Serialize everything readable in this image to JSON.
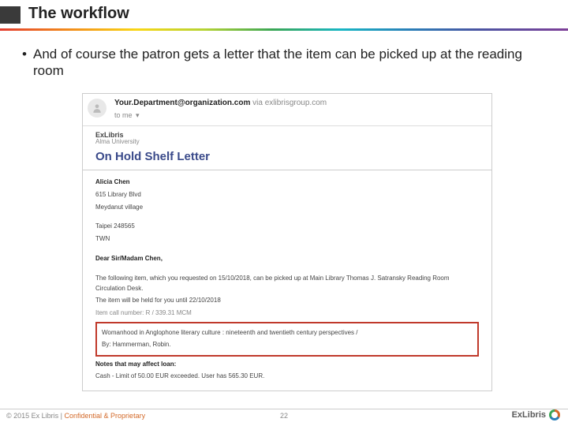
{
  "title": "The workflow",
  "bullet": "And of course the patron gets a letter that the item can be picked up at the reading room",
  "email": {
    "from": "Your.Department@organization.com",
    "via": "via exlibrisgroup.com",
    "to": "to me",
    "brand": "ExLibris",
    "brand_sub": "Alma University",
    "letter_title": "On Hold Shelf Letter",
    "addr_name": "Alicia Chen",
    "addr_blvd": "615 Library Blvd",
    "addr_city": "Meydanut village",
    "addr_taipei": "Taipei 248565",
    "addr_twn": "TWN",
    "greeting": "Dear Sir/Madam  Chen,",
    "para1": "The following item, which you requested on 15/10/2018, can be picked up at Main Library   Thomas J. Satransky Reading Room Circulation Desk.",
    "para2": "The item will be held for you until 22/10/2018",
    "para3": "Item call number: R / 339.31 MCM",
    "boxed_title": "Womanhood in Anglophone literary culture : nineteenth and twentieth century perspectives /",
    "boxed_by": "By: Hammerman, Robin.",
    "notes_heading": "Notes that may affect loan:",
    "notes_line": "Cash - Limit of 50.00 EUR exceeded. User has 565.30 EUR."
  },
  "footer": {
    "copyright": "© 2015 Ex Libris | ",
    "confidential": "Confidential & Proprietary",
    "page": "22",
    "logo": "ExLibris"
  }
}
